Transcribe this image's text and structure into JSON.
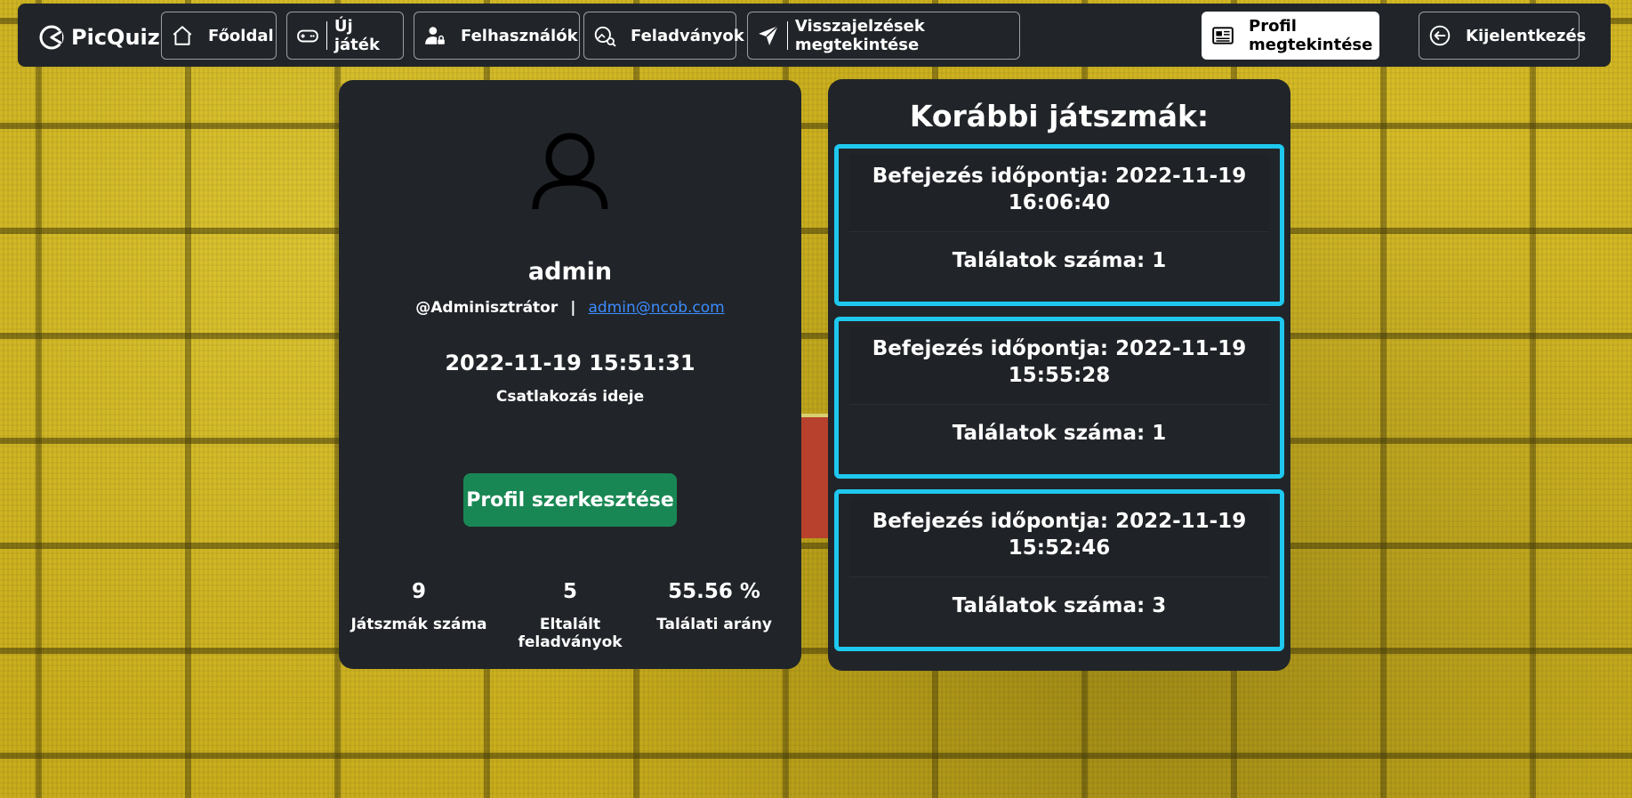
{
  "navbar": {
    "brand": "PicQuiz",
    "items": [
      {
        "label": "Főoldal",
        "icon": "home-icon"
      },
      {
        "label": "Új játék",
        "icon": "gamepad-icon"
      },
      {
        "label": "Felhasználók",
        "icon": "user-lock-icon"
      },
      {
        "label": "Feladványok",
        "icon": "image-search-icon"
      },
      {
        "label": "Visszajelzések megtekintése",
        "icon": "send-icon"
      }
    ],
    "right_items": [
      {
        "label": "Profil megtekintése",
        "icon": "newspaper-icon",
        "active": true
      },
      {
        "label": "Kijelentkezés",
        "icon": "logout-icon"
      }
    ]
  },
  "profile": {
    "username": "admin",
    "role": "@Adminisztrátor",
    "separator": "|",
    "email": "admin@ncob.com",
    "joined_date": "2022-11-19 15:51:31",
    "joined_label": "Csatlakozás ideje",
    "edit_button": "Profil szerkesztése",
    "stats": [
      {
        "value": "9",
        "label": "Játszmák száma"
      },
      {
        "value": "5",
        "label": "Eltalált feladványok"
      },
      {
        "value": "55.56 %",
        "label": "Találati arány"
      }
    ]
  },
  "games": {
    "title": "Korábbi játszmák:",
    "items": [
      {
        "finished_line1": "Befejezés időpontja: 2022-11-19",
        "finished_line2": "16:06:40",
        "hits": "Találatok száma: 1"
      },
      {
        "finished_line1": "Befejezés időpontja: 2022-11-19",
        "finished_line2": "15:55:28",
        "hits": "Találatok száma: 1"
      },
      {
        "finished_line1": "Befejezés időpontja: 2022-11-19",
        "finished_line2": "15:52:46",
        "hits": "Találatok száma: 3"
      }
    ]
  },
  "colors": {
    "card_bg": "#212529",
    "accent_border": "#1ec8ee",
    "edit_button": "#198754",
    "link": "#3d8bfd"
  }
}
